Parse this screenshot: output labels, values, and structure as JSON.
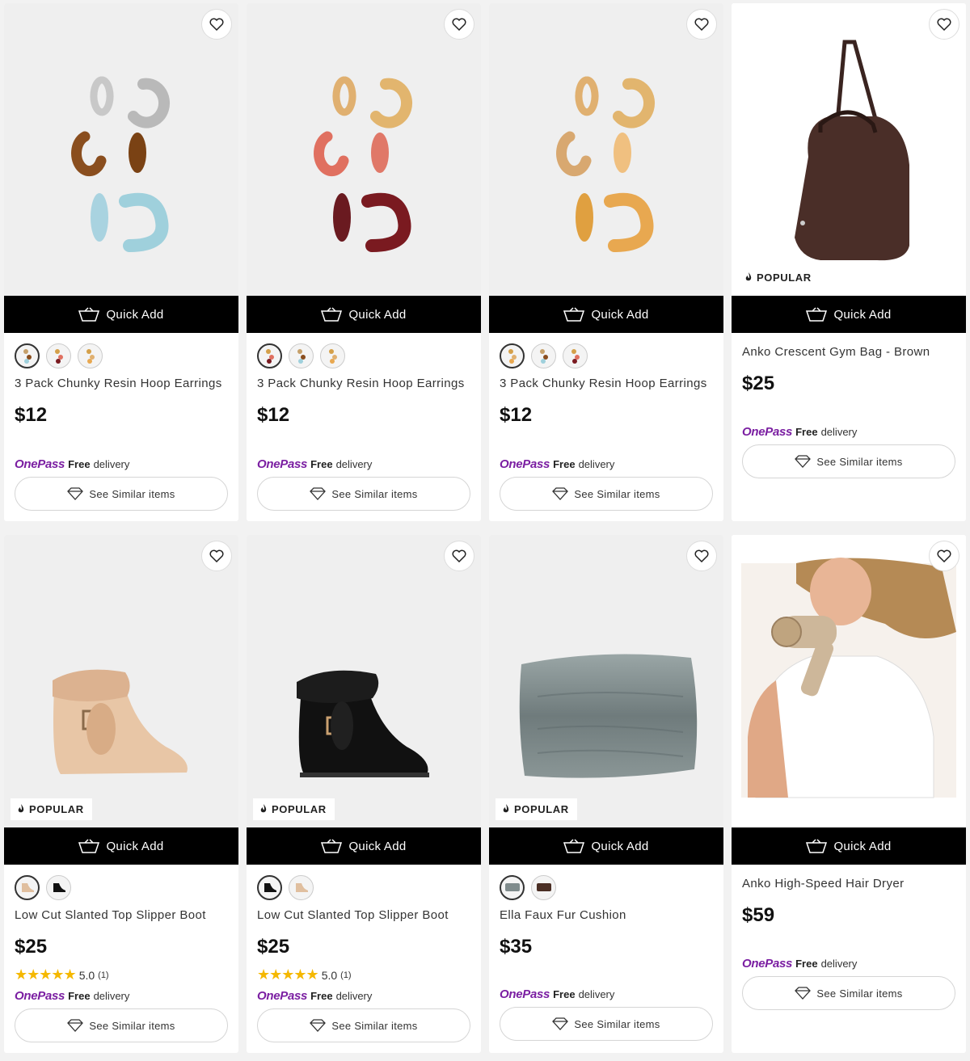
{
  "common": {
    "quick_add_label": "Quick Add",
    "similar_label": "See Similar items",
    "onepass_logo": "OnePass",
    "onepass_free": "Free",
    "onepass_delivery": "delivery",
    "popular_label": "POPULAR",
    "brand_color": "#7b1fa2",
    "star_color": "#f5b800"
  },
  "products": [
    {
      "title": "3 Pack Chunky Resin Hoop Earrings",
      "price": "$12",
      "image": "earrings-silver-brown-blue",
      "popular": false,
      "swatches": [
        "earrings-blue",
        "earrings-red",
        "earrings-amber"
      ]
    },
    {
      "title": "3 Pack Chunky Resin Hoop Earrings",
      "price": "$12",
      "image": "earrings-gold-red",
      "popular": false,
      "swatches": [
        "earrings-red",
        "earrings-blue",
        "earrings-amber"
      ]
    },
    {
      "title": "3 Pack Chunky Resin Hoop Earrings",
      "price": "$12",
      "image": "earrings-gold-amber",
      "popular": false,
      "swatches": [
        "earrings-amber",
        "earrings-blue",
        "earrings-red"
      ]
    },
    {
      "title": "Anko Crescent Gym Bag - Brown",
      "price": "$25",
      "image": "gym-bag-brown",
      "popular": true,
      "swatches": []
    },
    {
      "title": "Low Cut Slanted Top Slipper Boot",
      "price": "$25",
      "image": "slipper-boot-beige",
      "popular": true,
      "rating": "5.0",
      "rating_count": "(1)",
      "stars": 5,
      "swatches": [
        "boot-beige",
        "boot-black"
      ]
    },
    {
      "title": "Low Cut Slanted Top Slipper Boot",
      "price": "$25",
      "image": "slipper-boot-black",
      "popular": true,
      "rating": "5.0",
      "rating_count": "(1)",
      "stars": 5,
      "swatches": [
        "boot-black",
        "boot-beige"
      ]
    },
    {
      "title": "Ella Faux Fur Cushion",
      "price": "$35",
      "image": "faux-fur-cushion-grey",
      "popular": true,
      "swatches": [
        "cushion-grey",
        "cushion-brown"
      ]
    },
    {
      "title": "Anko High-Speed Hair Dryer",
      "price": "$59",
      "image": "hair-dryer-woman",
      "popular": false,
      "swatches": []
    }
  ]
}
